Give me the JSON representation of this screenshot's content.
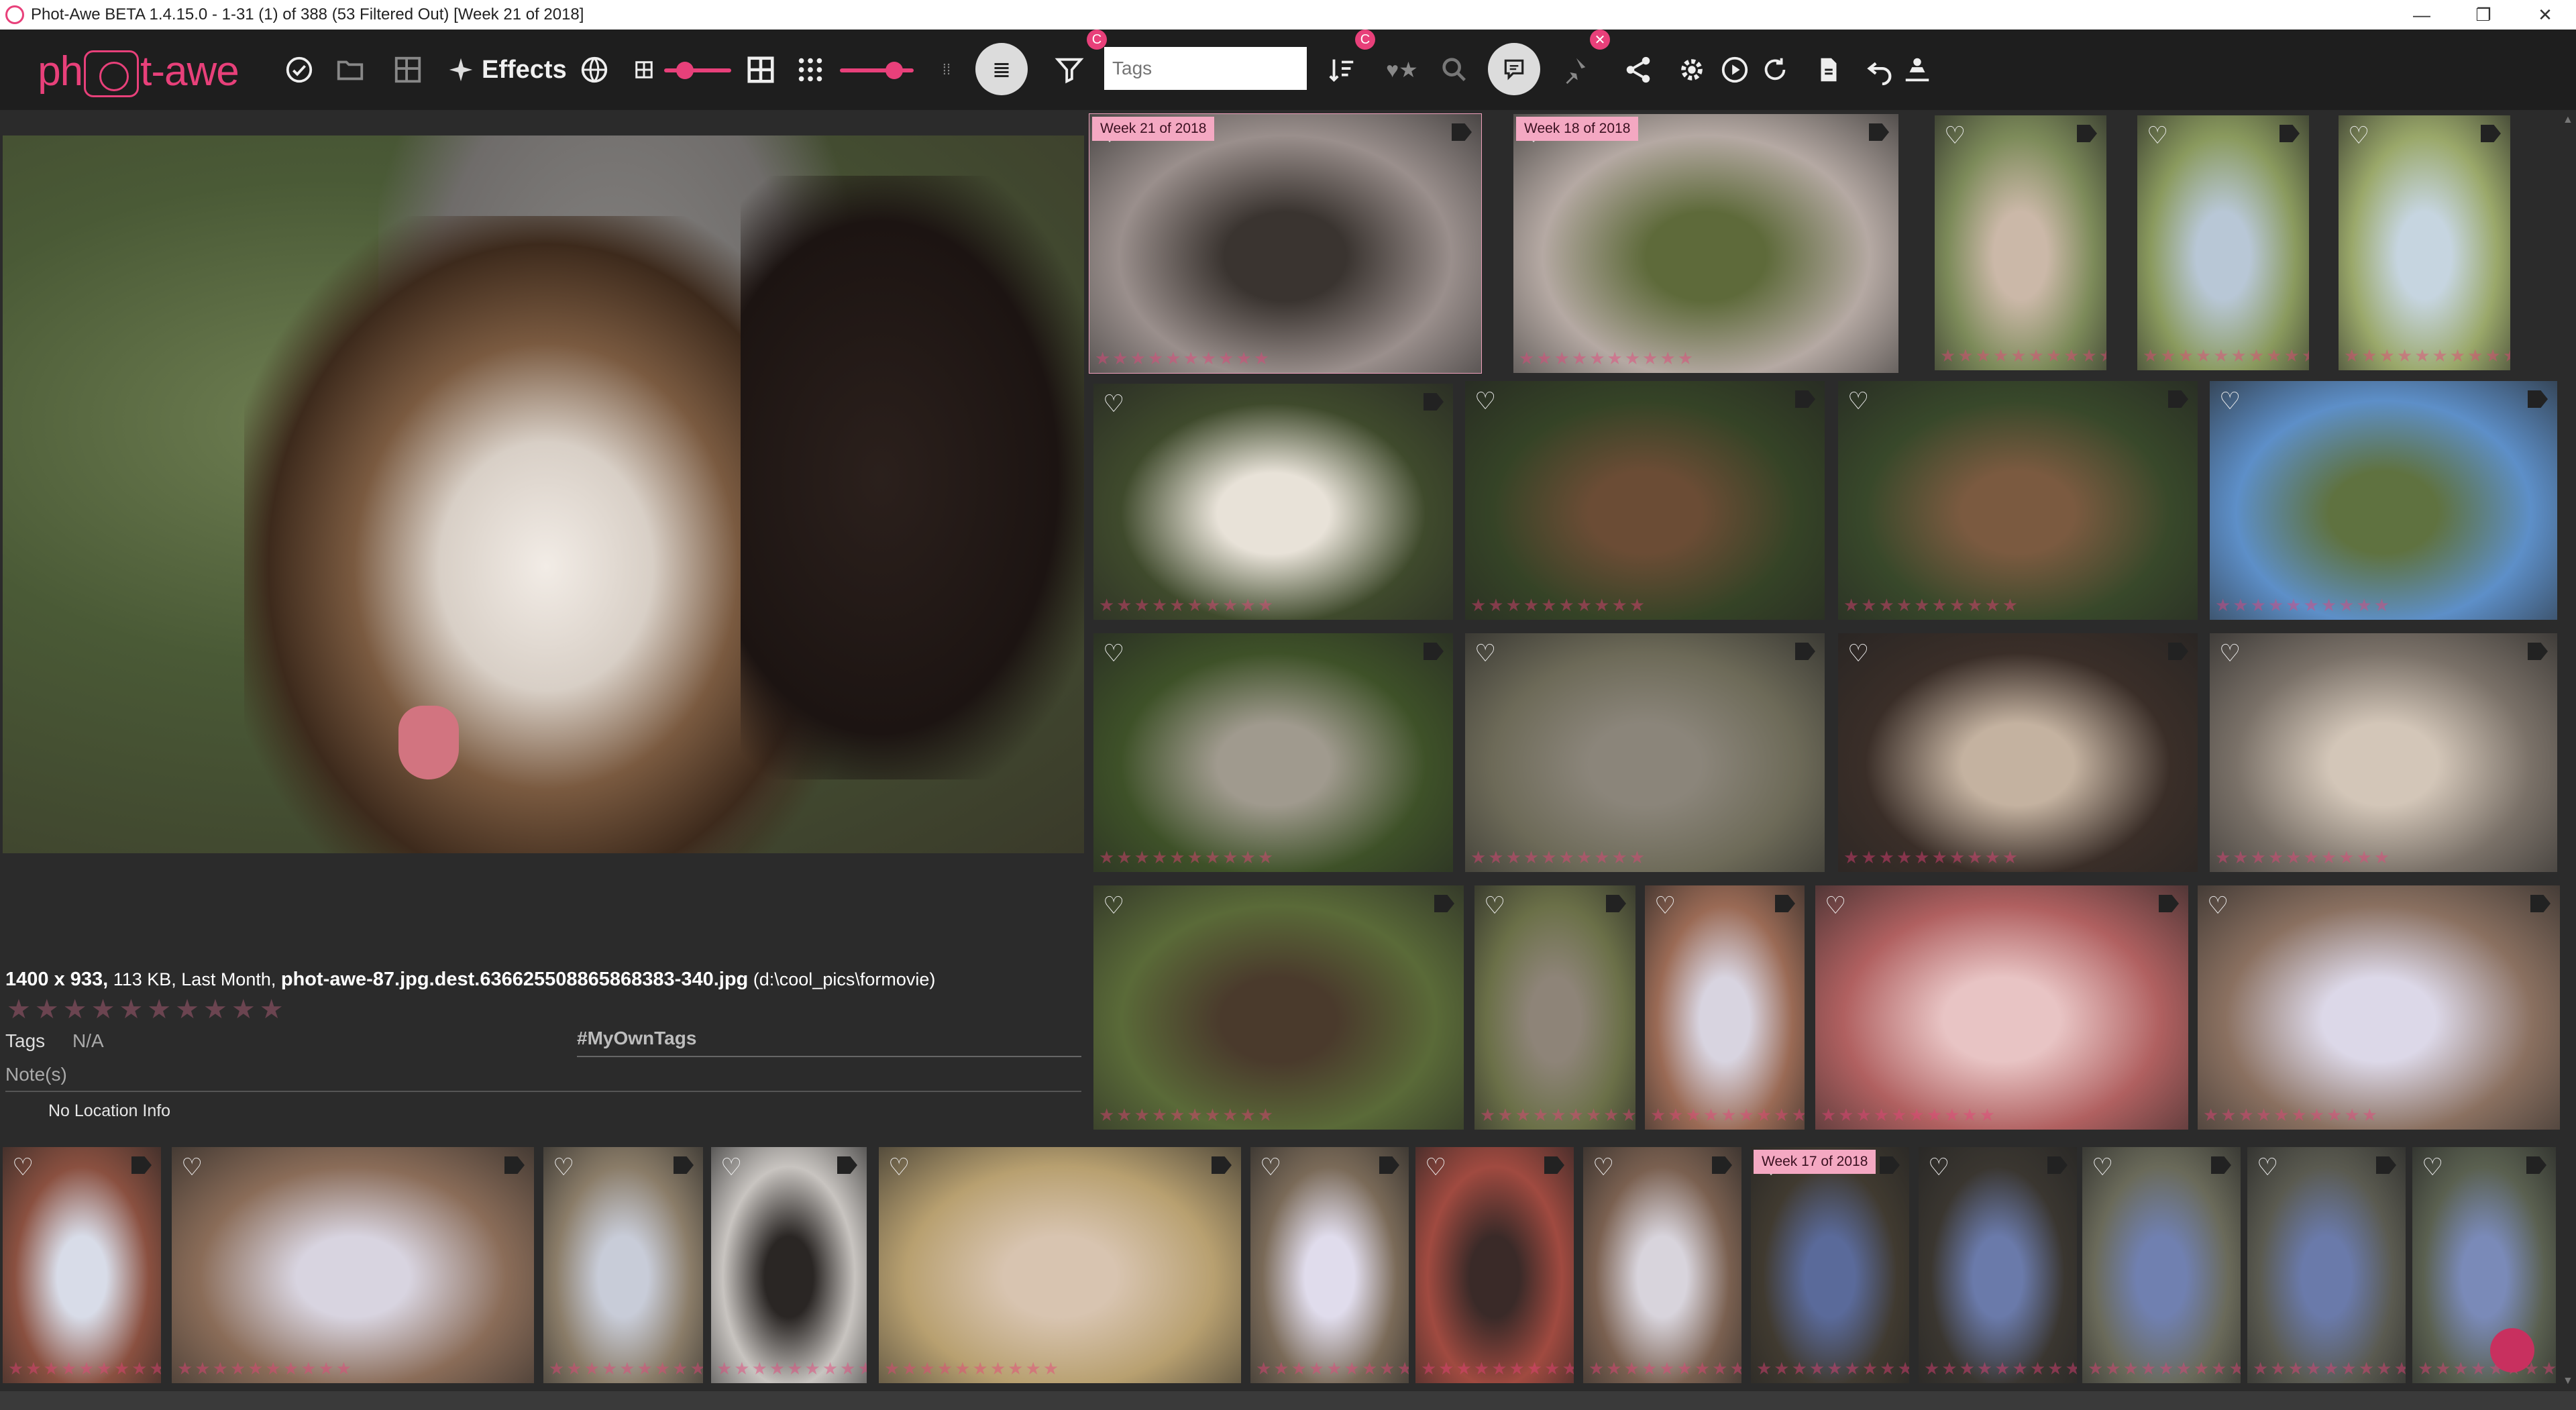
{
  "window": {
    "title": "Phot-Awe BETA 1.4.15.0 - 1-31 (1) of 388 (53 Filtered Out) [Week 21 of 2018]",
    "controls": [
      "—",
      "❐",
      "✕"
    ]
  },
  "toolbar": {
    "logo_text_a": "ph",
    "logo_text_b": "t-awe",
    "effects_label": "Effects",
    "tags_placeholder": "Tags",
    "icons": [
      "check-circle-icon",
      "folder-icon",
      "collage-icon",
      "sparkle-icon",
      "globe-icon",
      "small-grid-icon",
      "large-grid-icon",
      "dots-grid-icon",
      "list-icon",
      "filter-icon",
      "sort-icon",
      "heart-star-icon",
      "search-icon",
      "chat-icon",
      "pin-icon",
      "share-icon",
      "gear-icon",
      "play-icon",
      "refresh-icon",
      "document-icon",
      "undo-icon",
      "person-upload-icon"
    ],
    "badges": {
      "filter": "C",
      "sort": "C",
      "pin": "✕"
    }
  },
  "preview": {
    "meta_dims": "1400 x 933,",
    "meta_size": " 113 KB, Last Month, ",
    "meta_filename": "phot-awe-87.jpg.dest.636625508865868383-340.jpg",
    "meta_path": " (d:\\cool_pics\\formovie)",
    "stars": "★★★★★★★★★★",
    "rating": 0,
    "tags_label": "Tags",
    "tags_value": "N/A",
    "my_tags_placeholder": "#MyOwnTags",
    "notes_placeholder": "Note(s)",
    "location": "No Location Info"
  },
  "groups": {
    "week21": "Week 21 of 2018",
    "week18": "Week 18 of 2018",
    "week17": "Week 17 of 2018"
  },
  "thumb_stars": "★★★★★★★★★★",
  "colors": {
    "accent": "#e8407a",
    "background": "#2b2b2b",
    "toolbar": "#1e1e1e",
    "week_label": "#f4a8c2"
  }
}
